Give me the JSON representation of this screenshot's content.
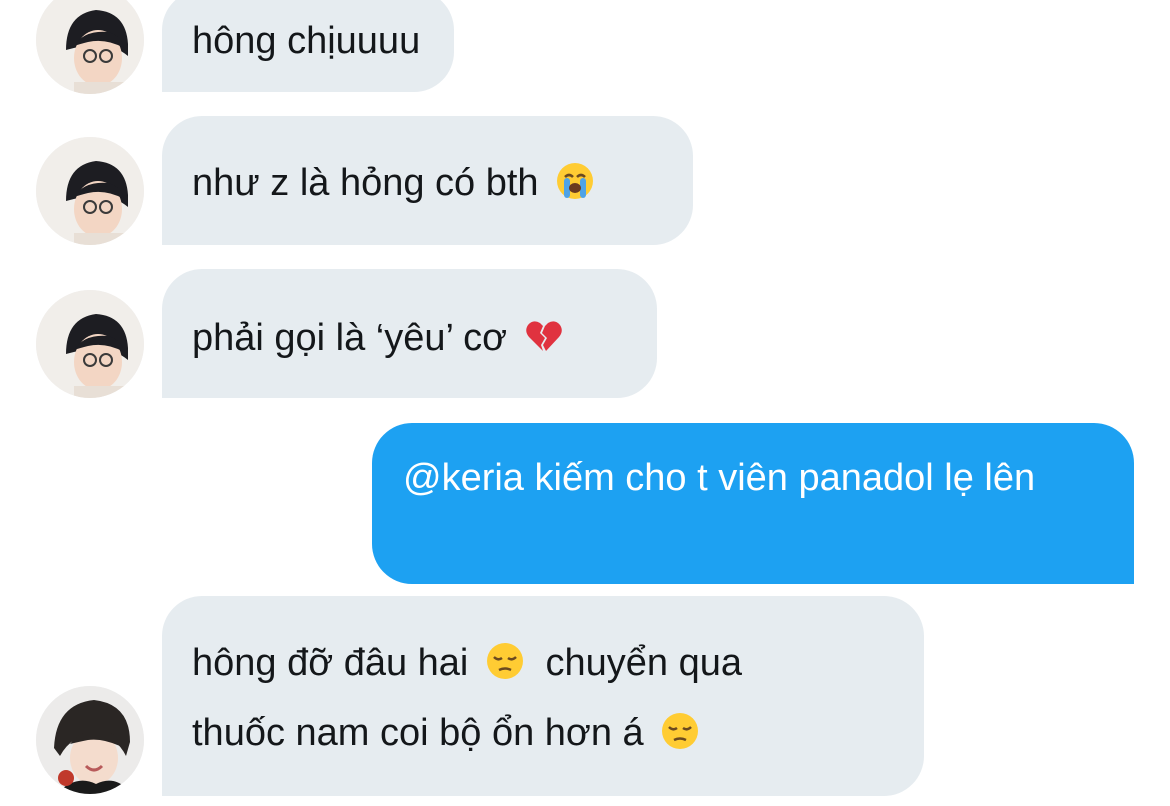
{
  "conversation": {
    "messages": [
      {
        "sender": "them",
        "text": "hông chịuuuu"
      },
      {
        "sender": "them",
        "text": "như z là hỏng có bth",
        "emoji": "loudly-crying-face"
      },
      {
        "sender": "them",
        "text": "phải gọi là ‘yêu’ cơ",
        "emoji": "broken-heart"
      },
      {
        "sender": "me",
        "text": "@keria kiếm cho t viên panadol lẹ lên"
      },
      {
        "sender": "them",
        "line1": "hông đỡ đâu hai",
        "emoji1": "pensive-face",
        "line2a": "chuyển qua",
        "line2": "thuốc nam coi bộ ổn hơn á",
        "emoji2": "pensive-face"
      }
    ]
  },
  "colors": {
    "incoming_bubble": "#e6ecf0",
    "outgoing_bubble": "#1da1f2",
    "incoming_text": "#14171a",
    "outgoing_text": "#ffffff"
  }
}
